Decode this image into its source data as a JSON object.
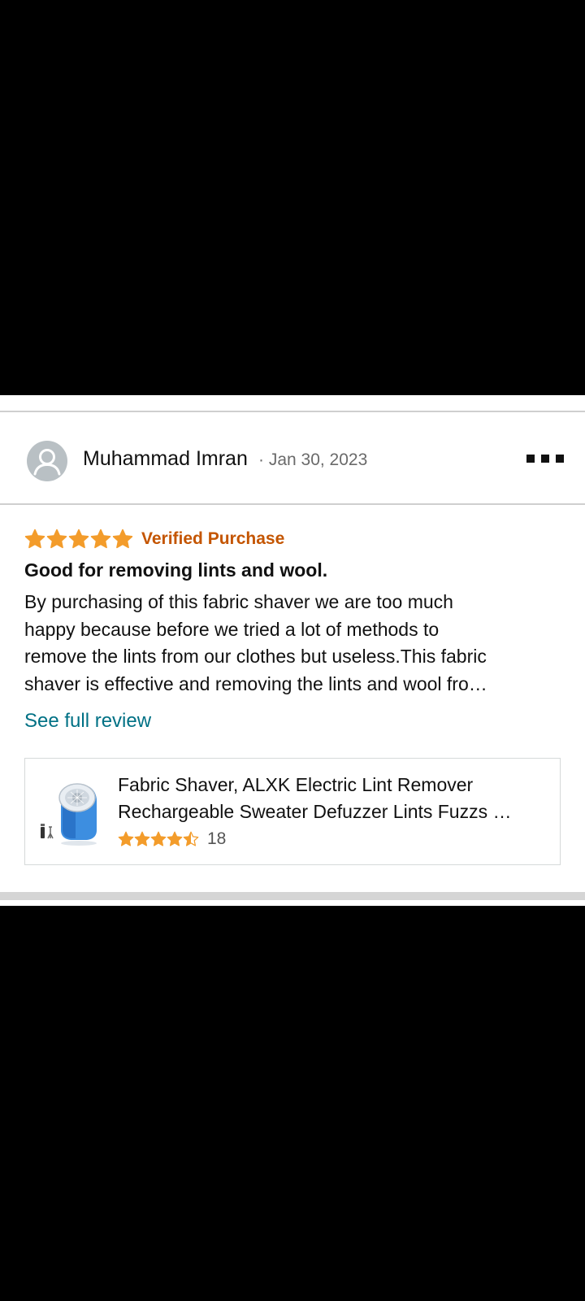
{
  "review": {
    "reviewer_name": "Muhammad Imran",
    "date": "· Jan 30, 2023",
    "rating": 5,
    "verified_label": "Verified Purchase",
    "title": "Good for removing lints and wool.",
    "body_lines": [
      "By purchasing of this fabric shaver we are too much",
      "happy because before we tried a lot of methods to",
      "remove the lints from our clothes but useless.This fabric",
      "shaver is effective and removing the lints and wool fro…"
    ],
    "see_full_label": "See full review"
  },
  "product": {
    "title_lines": [
      "Fabric Shaver, ALXK Electric Lint Remover",
      "Rechargeable Sweater Defuzzer Lints Fuzzs …"
    ],
    "rating": 4.5,
    "rating_count": "18"
  },
  "icons": {
    "avatar": "person-icon",
    "more": "more-options-icon",
    "star": "star-icon"
  },
  "colors": {
    "star": "#f39c2b",
    "verified": "#c45500",
    "link": "#007185",
    "avatar_bg": "#b9c0c4"
  }
}
